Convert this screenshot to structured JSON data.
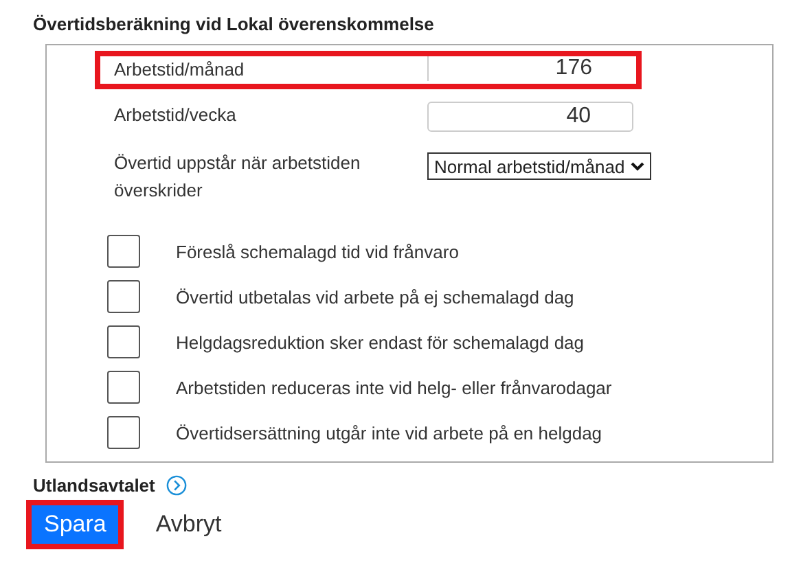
{
  "section_title": "Övertidsberäkning vid Lokal överenskommelse",
  "fields": [
    {
      "kind": "input",
      "label": "Arbetstid/månad",
      "value": "176",
      "highlighted": true
    },
    {
      "kind": "input",
      "label": "Arbetstid/vecka",
      "value": "40",
      "highlighted": false
    },
    {
      "kind": "select",
      "label": "Övertid uppstår när arbetstiden överskrider",
      "value": "Normal arbetstid/månad",
      "highlighted": false
    }
  ],
  "checkboxes": [
    {
      "label": "Föreslå schemalagd tid vid frånvaro",
      "checked": false
    },
    {
      "label": "Övertid utbetalas vid arbete på ej schemalagd dag",
      "checked": false
    },
    {
      "label": "Helgdagsreduktion sker endast för schemalagd dag",
      "checked": false
    },
    {
      "label": "Arbetstiden reduceras inte vid helg- eller frånvarodagar",
      "checked": false
    },
    {
      "label": "Övertidsersättning utgår inte vid arbete på en helgdag",
      "checked": false
    }
  ],
  "link": {
    "label": "Utlandsavtalet"
  },
  "buttons": [
    {
      "kind": "primary",
      "label": "Spara",
      "highlighted": true
    },
    {
      "kind": "plain",
      "label": "Avbryt",
      "highlighted": false
    }
  ]
}
